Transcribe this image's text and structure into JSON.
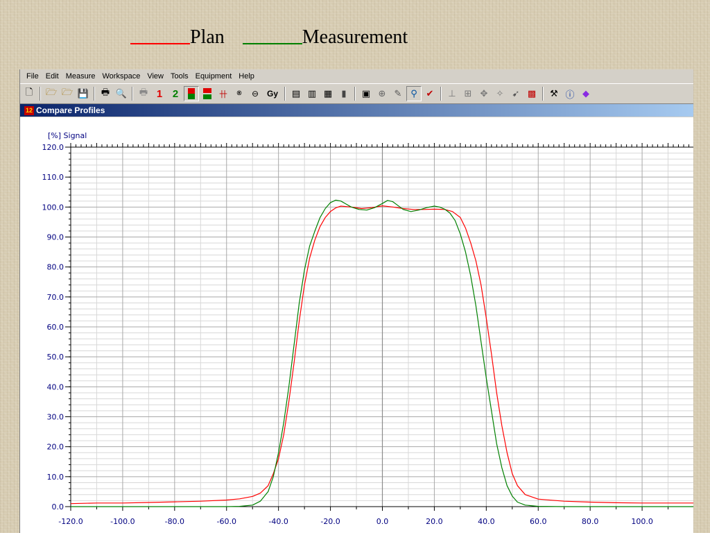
{
  "legend": {
    "plan_label": "Plan",
    "measurement_label": "Measurement",
    "plan_color": "#ff0000",
    "measurement_color": "#008000"
  },
  "menu": [
    "File",
    "Edit",
    "Measure",
    "Workspace",
    "View",
    "Tools",
    "Equipment",
    "Help"
  ],
  "toolbar": {
    "btn_1": "1",
    "btn_2": "2",
    "btn_gy": "Gy",
    "icons": [
      "new-icon",
      "open-icon",
      "open-special-icon",
      "save-icon",
      "print-icon",
      "print-preview-icon",
      "printer-setup-icon",
      "layer-1-icon",
      "layer-2-icon",
      "traffic-light-icon",
      "compare-icon",
      "profile-grid-icon",
      "roi-icon",
      "zoom-all-icon",
      "gy-icon",
      "document-icon",
      "info-table-icon",
      "m-table-icon",
      "histogram-icon",
      "point-icon",
      "globe-icon",
      "pen-icon",
      "scan-icon",
      "compare-check-icon",
      "measure-icon",
      "grid-measure-icon",
      "move-icon",
      "tools-icon",
      "arrow-icon",
      "scan-grid-icon",
      "hammer-icon",
      "info-icon",
      "book-icon"
    ]
  },
  "window": {
    "title": "Compare Profiles"
  },
  "chart_data": {
    "type": "line",
    "ylabel": "[%] Signal",
    "xlim": [
      -120,
      120
    ],
    "ylim": [
      0,
      120
    ],
    "xticks": [
      -120,
      -100,
      -80,
      -60,
      -40,
      -20,
      0,
      20,
      40,
      60,
      80,
      100
    ],
    "xtick_labels": [
      "-120.0",
      "-100.0",
      "-80.0",
      "-60.0",
      "-40.0",
      "-20.0",
      "0.0",
      "20.0",
      "40.0",
      "60.0",
      "80.0",
      "100.0"
    ],
    "yticks": [
      0,
      10,
      20,
      30,
      40,
      50,
      60,
      70,
      80,
      90,
      100,
      110,
      120
    ],
    "ytick_labels": [
      "0.0",
      "10.0",
      "20.0",
      "30.0",
      "40.0",
      "50.0",
      "60.0",
      "70.0",
      "80.0",
      "90.0",
      "100.0",
      "110.0",
      "120.0"
    ],
    "grid": true,
    "series": [
      {
        "name": "Plan",
        "color": "#ff0000",
        "x": [
          -120,
          -110,
          -100,
          -90,
          -80,
          -70,
          -60,
          -55,
          -50,
          -47,
          -44,
          -42,
          -40,
          -38,
          -36,
          -34,
          -32,
          -30,
          -28,
          -26,
          -24,
          -22,
          -20,
          -18,
          -16,
          -12,
          -8,
          -4,
          0,
          4,
          8,
          12,
          16,
          20,
          24,
          27,
          30,
          32,
          34,
          36,
          38,
          40,
          42,
          44,
          46,
          48,
          50,
          52,
          55,
          60,
          70,
          80,
          90,
          100,
          110,
          120
        ],
        "y": [
          1.0,
          1.2,
          1.2,
          1.4,
          1.6,
          1.8,
          2.2,
          2.6,
          3.4,
          4.5,
          7,
          11,
          16,
          24,
          35,
          48,
          62,
          74,
          83,
          89,
          93.5,
          96.5,
          98.5,
          99.7,
          100.3,
          100,
          99.5,
          99.8,
          100.4,
          100,
          99.5,
          99.2,
          99.2,
          99.3,
          99.2,
          98.5,
          96.5,
          93,
          88,
          82,
          74,
          63,
          51,
          38,
          27,
          18,
          11,
          7,
          4,
          2.5,
          1.8,
          1.5,
          1.3,
          1.2,
          1.2,
          1.2
        ]
      },
      {
        "name": "Measurement",
        "color": "#008000",
        "x": [
          -120,
          -110,
          -100,
          -90,
          -80,
          -70,
          -60,
          -55,
          -50,
          -47,
          -44,
          -42,
          -40,
          -38,
          -36,
          -34,
          -32,
          -30,
          -28,
          -26,
          -24,
          -22,
          -20,
          -18,
          -16,
          -14,
          -12,
          -9,
          -6,
          -3,
          0,
          2,
          4,
          6,
          8,
          11,
          14,
          17,
          20,
          22,
          24,
          26,
          28,
          30,
          32,
          34,
          36,
          38,
          40,
          42,
          44,
          46,
          48,
          50,
          52,
          55,
          60,
          70,
          80,
          90,
          100,
          110,
          120
        ],
        "y": [
          0,
          0,
          0,
          0,
          0,
          0,
          0,
          0.1,
          0.5,
          1.8,
          5,
          10,
          18,
          28,
          40,
          54,
          68,
          79,
          87,
          92,
          96.5,
          99.5,
          101.5,
          102.3,
          102,
          101,
          100,
          99.2,
          99,
          99.8,
          101.2,
          102.2,
          101.8,
          100.5,
          99.2,
          98.5,
          99,
          99.8,
          100.3,
          100,
          99.3,
          98,
          95.5,
          91,
          85,
          77,
          67,
          55,
          43,
          32,
          21,
          13,
          7,
          3.5,
          1.5,
          0.5,
          0.1,
          0,
          0,
          0,
          0,
          0,
          0
        ]
      }
    ]
  }
}
